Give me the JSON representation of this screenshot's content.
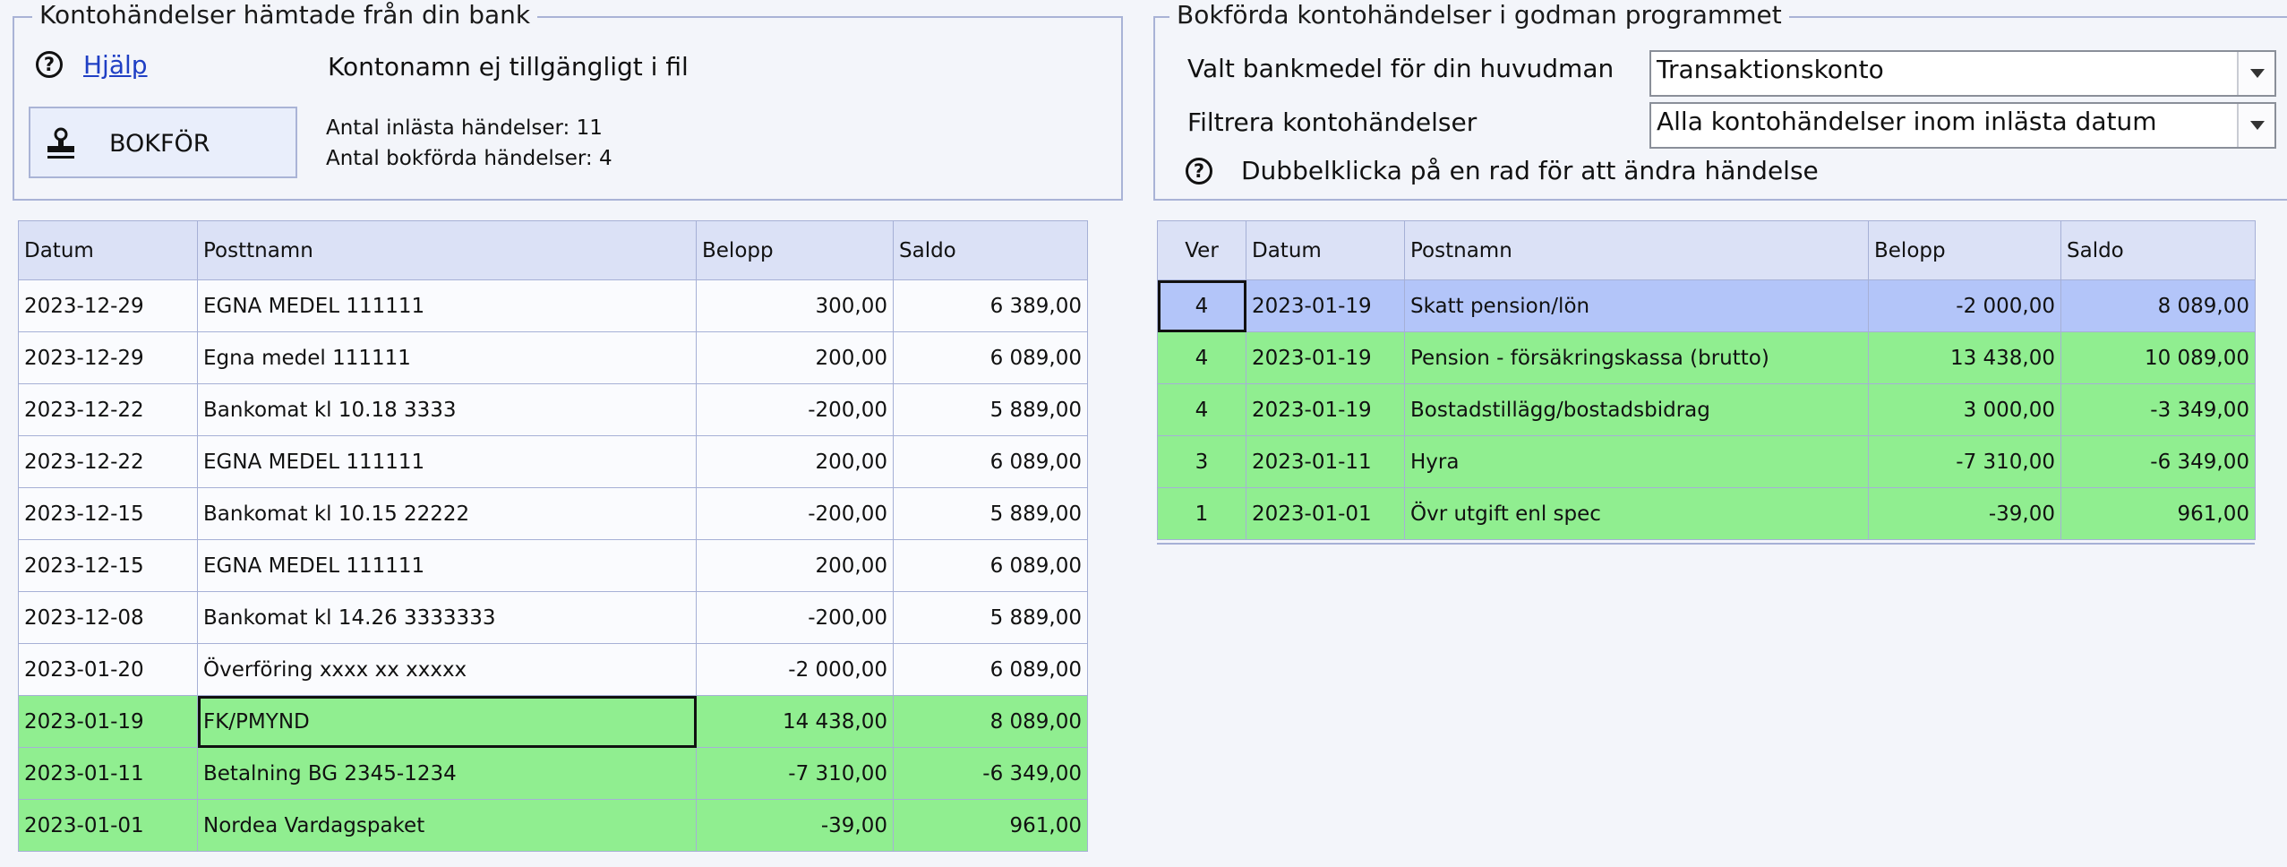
{
  "left_panel": {
    "title": "Kontohändelser hämtade från din bank",
    "help_link": "Hjälp",
    "account_name_text": "Kontonamn ej tillgängligt i fil",
    "book_button": "BOKFÖR",
    "loaded_count_text": "Antal inlästa händelser: 11",
    "booked_count_text": "Antal bokförda händelser: 4"
  },
  "right_panel": {
    "title": "Bokförda kontohändelser i godman programmet",
    "bank_label": "Valt bankmedel för din huvudman",
    "bank_value": "Transaktionskonto",
    "filter_label": "Filtrera kontohändelser",
    "filter_value": "Alla kontohändelser inom inlästa datum",
    "dblclick_hint": "Dubbelklicka på en rad för att ändra händelse"
  },
  "bank_table": {
    "headers": [
      "Datum",
      "Posttnamn",
      "Belopp",
      "Saldo"
    ],
    "rows": [
      {
        "date": "2023-12-29",
        "name": "EGNA MEDEL 111111",
        "amount": "300,00",
        "balance": "6 389,00",
        "status": "unbooked"
      },
      {
        "date": "2023-12-29",
        "name": "Egna medel 111111",
        "amount": "200,00",
        "balance": "6 089,00",
        "status": "unbooked"
      },
      {
        "date": "2023-12-22",
        "name": "Bankomat kl 10.18 3333",
        "amount": "-200,00",
        "balance": "5 889,00",
        "status": "unbooked"
      },
      {
        "date": "2023-12-22",
        "name": "EGNA MEDEL 111111",
        "amount": "200,00",
        "balance": "6 089,00",
        "status": "unbooked"
      },
      {
        "date": "2023-12-15",
        "name": "Bankomat kl 10.15 22222",
        "amount": "-200,00",
        "balance": "5 889,00",
        "status": "unbooked"
      },
      {
        "date": "2023-12-15",
        "name": "EGNA MEDEL 111111",
        "amount": "200,00",
        "balance": "6 089,00",
        "status": "unbooked"
      },
      {
        "date": "2023-12-08",
        "name": "Bankomat kl 14.26 3333333",
        "amount": "-200,00",
        "balance": "5 889,00",
        "status": "unbooked"
      },
      {
        "date": "2023-01-20",
        "name": "Överföring xxxx xx xxxxx",
        "amount": "-2 000,00",
        "balance": "6 089,00",
        "status": "unbooked"
      },
      {
        "date": "2023-01-19",
        "name": "FK/PMYND",
        "amount": "14 438,00",
        "balance": "8 089,00",
        "status": "booked"
      },
      {
        "date": "2023-01-11",
        "name": "Betalning BG 2345-1234",
        "amount": "-7 310,00",
        "balance": "-6 349,00",
        "status": "booked"
      },
      {
        "date": "2023-01-01",
        "name": "Nordea Vardagspaket",
        "amount": "-39,00",
        "balance": "961,00",
        "status": "booked"
      }
    ]
  },
  "booked_table": {
    "headers": [
      "Ver",
      "Datum",
      "Postnamn",
      "Belopp",
      "Saldo"
    ],
    "rows": [
      {
        "ver": "4",
        "date": "2023-01-19",
        "name": "Skatt pension/lön",
        "amount": "-2 000,00",
        "balance": "8 089,00",
        "status": "selected"
      },
      {
        "ver": "4",
        "date": "2023-01-19",
        "name": "Pension - försäkringskassa (brutto)",
        "amount": "13 438,00",
        "balance": "10 089,00",
        "status": "booked"
      },
      {
        "ver": "4",
        "date": "2023-01-19",
        "name": "Bostadstillägg/bostadsbidrag",
        "amount": "3 000,00",
        "balance": "-3 349,00",
        "status": "booked"
      },
      {
        "ver": "3",
        "date": "2023-01-11",
        "name": "Hyra",
        "amount": "-7 310,00",
        "balance": "-6 349,00",
        "status": "booked"
      },
      {
        "ver": "1",
        "date": "2023-01-01",
        "name": "Övr utgift enl spec",
        "amount": "-39,00",
        "balance": "961,00",
        "status": "booked"
      }
    ]
  },
  "colors": {
    "booked_row": "#90ee90",
    "selected_row": "#b3c5f9",
    "header_bg": "#dbe1f6",
    "border": "#a6b0d6"
  }
}
